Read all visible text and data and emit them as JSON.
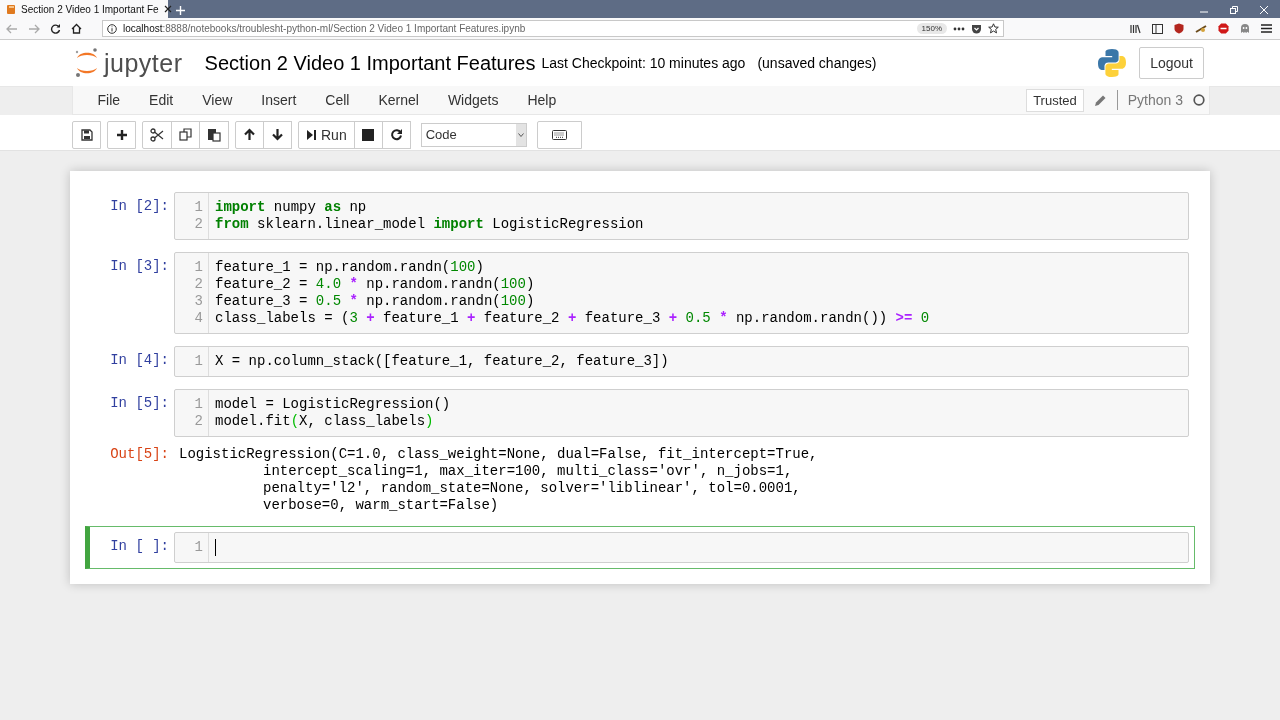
{
  "browser": {
    "tab_title": "Section 2 Video 1 Important Fe",
    "url_host": "localhost",
    "url_path": ":8888/notebooks/troublesht-python-ml/Section 2 Video 1 Important Features.ipynb",
    "zoom": "150%"
  },
  "header": {
    "logo_text": "jupyter",
    "title": "Section 2 Video 1 Important Features",
    "checkpoint": "Last Checkpoint: 10 minutes ago",
    "save_status": "(unsaved changes)",
    "logout": "Logout"
  },
  "menu": [
    "File",
    "Edit",
    "View",
    "Insert",
    "Cell",
    "Kernel",
    "Widgets",
    "Help"
  ],
  "kernel": {
    "trusted": "Trusted",
    "name": "Python 3"
  },
  "toolbar": {
    "run": "Run",
    "cell_type": "Code"
  },
  "cells": [
    {
      "prompt": "In [2]:",
      "selected": false,
      "lines": [
        {
          "number": "1",
          "tokens": [
            {
              "text": "import",
              "kind": "kw"
            },
            {
              "text": " numpy ",
              "kind": "plain"
            },
            {
              "text": "as",
              "kind": "kw"
            },
            {
              "text": " np",
              "kind": "plain"
            }
          ]
        },
        {
          "number": "2",
          "tokens": [
            {
              "text": "from",
              "kind": "kw"
            },
            {
              "text": " sklearn.linear_model ",
              "kind": "plain"
            },
            {
              "text": "import",
              "kind": "kw"
            },
            {
              "text": " LogisticRegression",
              "kind": "plain"
            }
          ]
        }
      ]
    },
    {
      "prompt": "In [3]:",
      "selected": false,
      "lines": [
        {
          "number": "1",
          "tokens": [
            {
              "text": "feature_1 = np.random.randn(",
              "kind": "plain"
            },
            {
              "text": "100",
              "kind": "num"
            },
            {
              "text": ")",
              "kind": "plain"
            }
          ]
        },
        {
          "number": "2",
          "tokens": [
            {
              "text": "feature_2 = ",
              "kind": "plain"
            },
            {
              "text": "4.0",
              "kind": "num"
            },
            {
              "text": " *",
              "kind": "op"
            },
            {
              "text": " np.random.randn(",
              "kind": "plain"
            },
            {
              "text": "100",
              "kind": "num"
            },
            {
              "text": ")",
              "kind": "plain"
            }
          ]
        },
        {
          "number": "3",
          "tokens": [
            {
              "text": "feature_3 = ",
              "kind": "plain"
            },
            {
              "text": "0.5",
              "kind": "num"
            },
            {
              "text": " *",
              "kind": "op"
            },
            {
              "text": " np.random.randn(",
              "kind": "plain"
            },
            {
              "text": "100",
              "kind": "num"
            },
            {
              "text": ")",
              "kind": "plain"
            }
          ]
        },
        {
          "number": "4",
          "tokens": [
            {
              "text": "class_labels = (",
              "kind": "plain"
            },
            {
              "text": "3",
              "kind": "num"
            },
            {
              "text": " +",
              "kind": "op"
            },
            {
              "text": " feature_1 ",
              "kind": "plain"
            },
            {
              "text": "+",
              "kind": "op"
            },
            {
              "text": " feature_2 ",
              "kind": "plain"
            },
            {
              "text": "+",
              "kind": "op"
            },
            {
              "text": " feature_3 ",
              "kind": "plain"
            },
            {
              "text": "+ ",
              "kind": "op"
            },
            {
              "text": "0.5",
              "kind": "num"
            },
            {
              "text": " *",
              "kind": "op"
            },
            {
              "text": " np.random.randn()) ",
              "kind": "plain"
            },
            {
              "text": ">= ",
              "kind": "op"
            },
            {
              "text": "0",
              "kind": "num"
            }
          ]
        }
      ]
    },
    {
      "prompt": "In [4]:",
      "selected": false,
      "lines": [
        {
          "number": "1",
          "tokens": [
            {
              "text": "X = np.column_stack([feature_1, feature_2, feature_3])",
              "kind": "plain"
            }
          ]
        }
      ]
    },
    {
      "prompt": "In [5]:",
      "selected": false,
      "lines": [
        {
          "number": "1",
          "tokens": [
            {
              "text": "model = LogisticRegression()",
              "kind": "plain"
            }
          ]
        },
        {
          "number": "2",
          "tokens": [
            {
              "text": "model.fit",
              "kind": "plain"
            },
            {
              "text": "(",
              "kind": "bracket"
            },
            {
              "text": "X, class_labels",
              "kind": "plain"
            },
            {
              "text": ")",
              "kind": "bracket"
            }
          ]
        }
      ],
      "output": {
        "prompt": "Out[5]:",
        "lines": [
          "LogisticRegression(C=1.0, class_weight=None, dual=False, fit_intercept=True,",
          "          intercept_scaling=1, max_iter=100, multi_class='ovr', n_jobs=1,",
          "          penalty='l2', random_state=None, solver='liblinear', tol=0.0001,",
          "          verbose=0, warm_start=False)"
        ]
      }
    },
    {
      "prompt": "In [ ]:",
      "selected": true,
      "lines": [
        {
          "number": "1"
        }
      ]
    }
  ]
}
